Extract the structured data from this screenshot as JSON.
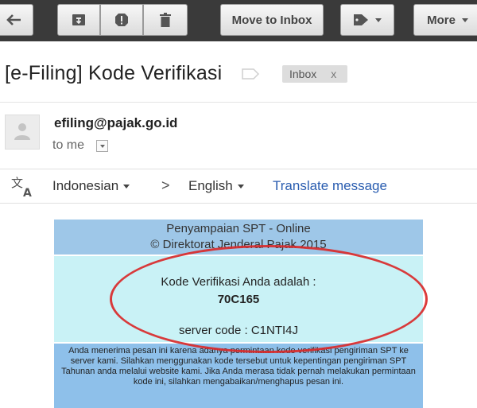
{
  "toolbar": {
    "move_to_inbox": "Move to Inbox",
    "more": "More"
  },
  "email": {
    "subject": "[e-Filing] Kode Verifikasi",
    "label_chip": "Inbox",
    "label_chip_close": "x",
    "sender": "efiling@pajak.go.id",
    "to": "to me"
  },
  "translate": {
    "from_lang": "Indonesian",
    "arrow": ">",
    "to_lang": "English",
    "action": "Translate message"
  },
  "body": {
    "header_line1": "Penyampaian SPT - Online",
    "header_line2": "© Direktorat Jenderal Pajak 2015",
    "code_label": "Kode Verifikasi Anda adalah :",
    "code": "70C165",
    "server_code": "server code : C1NTI4J",
    "footer": "Anda menerima pesan ini karena adanya permintaan kode verifikasi pengiriman SPT ke server kami. Silahkan menggunakan kode tersebut untuk kepentingan pengiriman SPT Tahunan anda melalui website kami. Jika Anda merasa tidak pernah melakukan permintaan kode ini, silahkan mengabaikan/menghapus pesan ini."
  },
  "colors": {
    "toolbar_bg": "#3a3a3a",
    "header_band": "#9ec7e8",
    "code_band": "#c9f2f6",
    "footer_band": "#8ec0ea",
    "annotation_red": "#d92a2a",
    "link_blue": "#2a5db0"
  },
  "icons": [
    "back-arrow-icon",
    "archive-icon",
    "report-spam-icon",
    "trash-icon",
    "label-tag-icon",
    "label-outline-icon",
    "person-icon",
    "translate-icon"
  ]
}
